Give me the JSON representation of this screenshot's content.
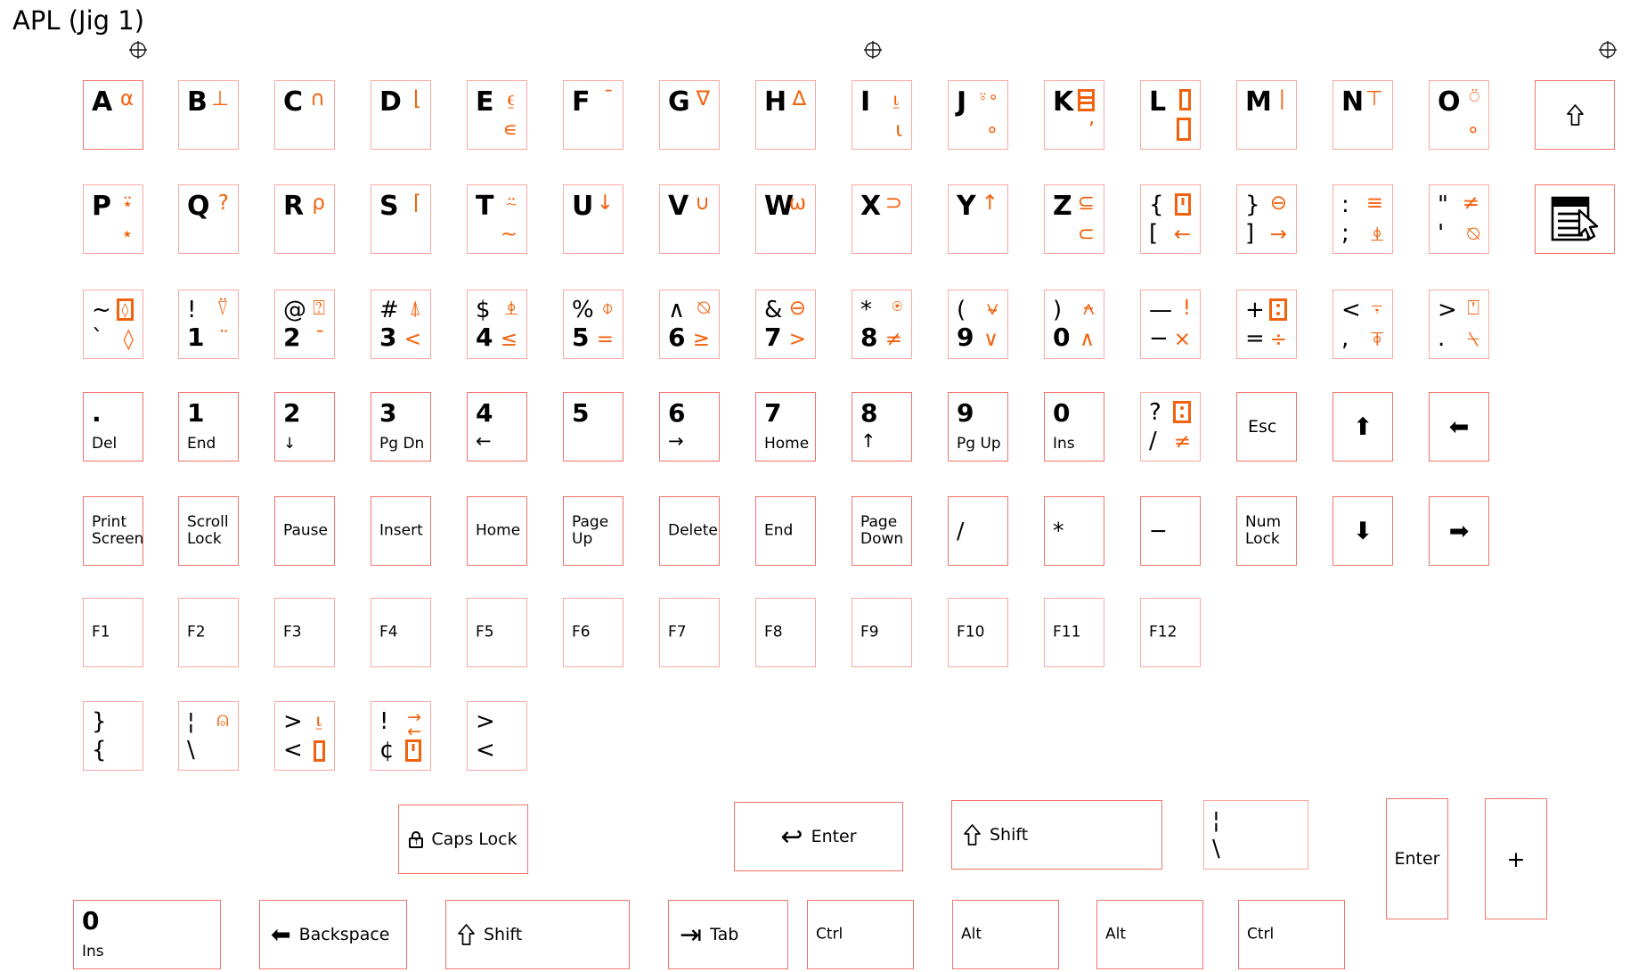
{
  "page": {
    "title": "APL (Jig 1)",
    "accent_key_border": "#f4736a",
    "accent_glyph": "#f2610c",
    "text_color": "#000000",
    "background": "#ffffff",
    "registration_mark": "crosshair-circle"
  },
  "rows": {
    "letters_1": [
      {
        "name": "a",
        "base": "A",
        "apl_top": "⍺"
      },
      {
        "name": "b",
        "base": "B",
        "apl_top": "⊥"
      },
      {
        "name": "c",
        "base": "C",
        "apl_top": "∩"
      },
      {
        "name": "d",
        "base": "D",
        "apl_top": "⌊"
      },
      {
        "name": "e",
        "base": "E",
        "apl_top": "⍷",
        "apl_bottom": "∊"
      },
      {
        "name": "f",
        "base": "F",
        "apl_top": "¯"
      },
      {
        "name": "g",
        "base": "G",
        "apl_top": "∇"
      },
      {
        "name": "h",
        "base": "H",
        "apl_top": "∆"
      },
      {
        "name": "i",
        "base": "I",
        "apl_top": "⍸",
        "apl_bottom": "⍳"
      },
      {
        "name": "j",
        "base": "J",
        "apl_top": "⍤∘",
        "apl_bottom": "∘"
      },
      {
        "name": "k",
        "base": "K",
        "apl_top": "tofu-rows",
        "apl_bottom": "ʼ"
      },
      {
        "name": "l",
        "base": "L",
        "apl_top": "tofu-v1",
        "apl_bottom": "tofu-v2"
      },
      {
        "name": "m",
        "base": "M",
        "apl_top": "∣"
      },
      {
        "name": "n",
        "base": "N",
        "apl_top": "⊤"
      },
      {
        "name": "o",
        "base": "O",
        "apl_top": "⍥",
        "apl_bottom": "∘"
      },
      {
        "name": "shift-up",
        "glyph": "shift-arrow"
      }
    ],
    "letters_2": [
      {
        "name": "p",
        "base": "P",
        "apl_top": "⍣",
        "apl_bottom": "⋆"
      },
      {
        "name": "q",
        "base": "Q",
        "apl_top": "?"
      },
      {
        "name": "r",
        "base": "R",
        "apl_top": "⍴"
      },
      {
        "name": "s",
        "base": "S",
        "apl_top": "⌈"
      },
      {
        "name": "t",
        "base": "T",
        "apl_top": "⍨",
        "apl_bottom": "∼"
      },
      {
        "name": "u",
        "base": "U",
        "apl_top": "↓"
      },
      {
        "name": "v",
        "base": "V",
        "apl_top": "∪"
      },
      {
        "name": "w",
        "base": "W",
        "apl_top": "⍵"
      },
      {
        "name": "x",
        "base": "X",
        "apl_top": "⊃"
      },
      {
        "name": "y",
        "base": "Y",
        "apl_top": "↑"
      },
      {
        "name": "z",
        "base": "Z",
        "apl_top": "⊆",
        "apl_bottom": "⊂"
      },
      {
        "name": "bracket-left",
        "base": "{",
        "base_bottom": "[",
        "apl_top": "tofu-quad",
        "apl_bottom": "←"
      },
      {
        "name": "bracket-right",
        "base": "}",
        "base_bottom": "]",
        "apl_top": "⊖",
        "apl_bottom": "→"
      },
      {
        "name": "semicolon",
        "base": ":",
        "base_bottom": ";",
        "apl_top": "≡",
        "apl_bottom": "⍎"
      },
      {
        "name": "quote",
        "base": "\"",
        "base_bottom": "'",
        "apl_top": "≠",
        "apl_bottom": "⍉"
      },
      {
        "name": "notepad",
        "glyph": "notepad-cursor-icon"
      }
    ],
    "numbers": [
      {
        "name": "grave",
        "base_top": "~",
        "base_bottom": "`",
        "apl_top": "tofu-diamond",
        "apl_bottom": "◊"
      },
      {
        "name": "one",
        "base_top": "!",
        "base_bottom": "1",
        "apl_top": "⍢",
        "apl_bottom": "¨"
      },
      {
        "name": "two",
        "base_top": "@",
        "base_bottom": "2",
        "apl_top": "⍰",
        "apl_bottom": "¯"
      },
      {
        "name": "three",
        "base_top": "#",
        "base_bottom": "3",
        "apl_top": "⍋",
        "apl_bottom": "<"
      },
      {
        "name": "four",
        "base_top": "$",
        "base_bottom": "4",
        "apl_top": "⍎",
        "apl_bottom": "≤"
      },
      {
        "name": "five",
        "base_top": "%",
        "base_bottom": "5",
        "apl_top": "⌽",
        "apl_bottom": "="
      },
      {
        "name": "six",
        "base_top": "∧",
        "base_bottom": "6",
        "apl_top": "⍉",
        "apl_bottom": "≥"
      },
      {
        "name": "seven",
        "base_top": "&",
        "base_bottom": "7",
        "apl_top": "⊖",
        "apl_bottom": ">"
      },
      {
        "name": "eight",
        "base_top": "*",
        "base_bottom": "8",
        "apl_top": "⍟",
        "apl_bottom": "≠"
      },
      {
        "name": "nine",
        "base_top": "(",
        "base_bottom": "9",
        "apl_top": "⍱",
        "apl_bottom": "∨"
      },
      {
        "name": "zero",
        "base_top": ")",
        "base_bottom": "0",
        "apl_top": "⍲",
        "apl_bottom": "∧"
      },
      {
        "name": "minus",
        "base_top": "—",
        "base_bottom": "−",
        "apl_top": "!",
        "apl_bottom": "×"
      },
      {
        "name": "equals",
        "base_top": "+",
        "base_bottom": "=",
        "apl_top": "tofu-dots",
        "apl_bottom": "÷"
      },
      {
        "name": "comma",
        "base_top": "<",
        "base_bottom": ",",
        "apl_top": "⍪",
        "apl_bottom": "⍕"
      },
      {
        "name": "period",
        "base_top": ">",
        "base_bottom": ".",
        "apl_top": "⍞",
        "apl_bottom": "⍀"
      }
    ],
    "numpad": [
      {
        "name": "numpad-del",
        "top": ".",
        "bottom": "Del"
      },
      {
        "name": "numpad-1-end",
        "top": "1",
        "bottom": "End"
      },
      {
        "name": "numpad-2-down",
        "top": "2",
        "bottom": "↓"
      },
      {
        "name": "numpad-3-pgdn",
        "top": "3",
        "bottom": "Pg Dn"
      },
      {
        "name": "numpad-4-left",
        "top": "4",
        "bottom": "←"
      },
      {
        "name": "numpad-5",
        "top": "5",
        "bottom": ""
      },
      {
        "name": "numpad-6-right",
        "top": "6",
        "bottom": "→"
      },
      {
        "name": "numpad-7-home",
        "top": "7",
        "bottom": "Home"
      },
      {
        "name": "numpad-8-up",
        "top": "8",
        "bottom": "↑"
      },
      {
        "name": "numpad-9-pgup",
        "top": "9",
        "bottom": "Pg Up"
      },
      {
        "name": "numpad-0-ins",
        "top": "0",
        "bottom": "Ins"
      },
      {
        "name": "slash-question",
        "top": "?",
        "bottom": "/",
        "apl_top": "tofu-dots",
        "apl_bottom": "≠"
      },
      {
        "name": "esc",
        "center": "Esc"
      },
      {
        "name": "arrow-up",
        "center": "⬆"
      },
      {
        "name": "arrow-left",
        "center": "⬅"
      }
    ],
    "nav": [
      {
        "name": "print-screen",
        "label": "Print\nScreen"
      },
      {
        "name": "scroll-lock",
        "label": "Scroll\nLock"
      },
      {
        "name": "pause",
        "label": "Pause"
      },
      {
        "name": "insert",
        "label": "Insert"
      },
      {
        "name": "home",
        "label": "Home"
      },
      {
        "name": "page-up",
        "label": "Page\nUp"
      },
      {
        "name": "delete",
        "label": "Delete"
      },
      {
        "name": "end",
        "label": "End"
      },
      {
        "name": "page-down",
        "label": "Page\nDown"
      },
      {
        "name": "numpad-divide",
        "label": "/"
      },
      {
        "name": "numpad-multiply",
        "label": "*"
      },
      {
        "name": "numpad-minus",
        "label": "−"
      },
      {
        "name": "num-lock",
        "label": "Num\nLock"
      },
      {
        "name": "arrow-down",
        "label": "⬇"
      },
      {
        "name": "arrow-right",
        "label": "➡"
      }
    ],
    "function": [
      {
        "name": "f1",
        "label": "F1"
      },
      {
        "name": "f2",
        "label": "F2"
      },
      {
        "name": "f3",
        "label": "F3"
      },
      {
        "name": "f4",
        "label": "F4"
      },
      {
        "name": "f5",
        "label": "F5"
      },
      {
        "name": "f6",
        "label": "F6"
      },
      {
        "name": "f7",
        "label": "F7"
      },
      {
        "name": "f8",
        "label": "F8"
      },
      {
        "name": "f9",
        "label": "F9"
      },
      {
        "name": "f10",
        "label": "F10"
      },
      {
        "name": "f11",
        "label": "F11"
      },
      {
        "name": "f12",
        "label": "F12"
      }
    ],
    "extras": [
      {
        "name": "brace-pair",
        "top": "}",
        "bottom": "{"
      },
      {
        "name": "pipe-backslash",
        "top": "¦",
        "bottom": "\\",
        "apl_top": "⍝"
      },
      {
        "name": "angle-pair",
        "top": ">",
        "bottom": "<",
        "apl_top": "⍸",
        "apl_bottom": "tofu-v1"
      },
      {
        "name": "bang-cent",
        "top": "!",
        "bottom": "¢",
        "apl_top": "→←",
        "apl_bottom": "tofu-quad"
      },
      {
        "name": "angle-pair-2",
        "top": ">",
        "bottom": "<"
      }
    ],
    "modifiers": [
      {
        "name": "caps-lock",
        "label": "Caps Lock",
        "icon": "lock-icon"
      },
      {
        "name": "enter",
        "label": "Enter",
        "icon": "enter-arrow-icon"
      },
      {
        "name": "shift",
        "label": "Shift",
        "icon": "shift-arrow-icon"
      },
      {
        "name": "pipe-backslash-2",
        "top": "¦",
        "bottom": "\\"
      }
    ],
    "bottom": [
      {
        "name": "numpad-0-ins-wide",
        "top": "0",
        "bottom": "Ins"
      },
      {
        "name": "backspace",
        "label": "Backspace",
        "icon": "left-arrow-icon"
      },
      {
        "name": "shift-2",
        "label": "Shift",
        "icon": "shift-arrow-icon"
      },
      {
        "name": "tab",
        "label": "Tab",
        "icon": "tab-arrow-icon"
      },
      {
        "name": "ctrl-left",
        "label": "Ctrl"
      },
      {
        "name": "alt-left",
        "label": "Alt"
      },
      {
        "name": "alt-right",
        "label": "Alt"
      },
      {
        "name": "ctrl-right",
        "label": "Ctrl"
      },
      {
        "name": "numpad-enter",
        "label": "Enter"
      },
      {
        "name": "numpad-plus",
        "label": "+"
      }
    ]
  }
}
